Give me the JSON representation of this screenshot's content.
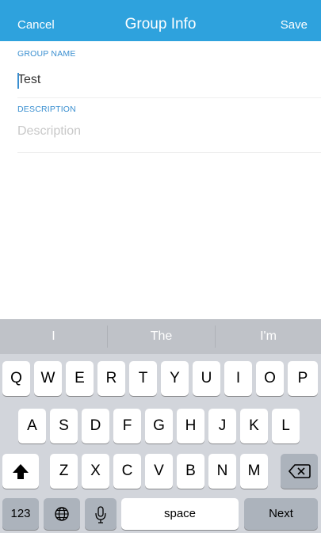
{
  "navbar": {
    "cancel_label": "Cancel",
    "title": "Group Info",
    "save_label": "Save",
    "color": "#2ea2dd"
  },
  "form": {
    "group_name": {
      "label": "GROUP NAME",
      "value": "Test"
    },
    "description": {
      "label": "DESCRIPTION",
      "placeholder": "Description",
      "value": ""
    }
  },
  "keyboard": {
    "suggestions": [
      "I",
      "The",
      "I'm"
    ],
    "row1": [
      "Q",
      "W",
      "E",
      "R",
      "T",
      "Y",
      "U",
      "I",
      "O",
      "P"
    ],
    "row2": [
      "A",
      "S",
      "D",
      "F",
      "G",
      "H",
      "J",
      "K",
      "L"
    ],
    "row3": [
      "Z",
      "X",
      "C",
      "V",
      "B",
      "N",
      "M"
    ],
    "numbers_label": "123",
    "space_label": "space",
    "next_label": "Next",
    "icons": {
      "shift": "shift-icon",
      "backspace": "backspace-icon",
      "globe": "globe-icon",
      "mic": "microphone-icon"
    }
  }
}
